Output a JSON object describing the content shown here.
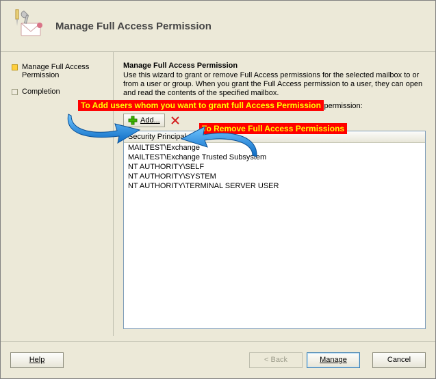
{
  "dialog": {
    "title": "Manage Full Access Permission"
  },
  "sidebar": {
    "steps": [
      {
        "label": "Manage Full Access Permission",
        "active": true
      },
      {
        "label": "Completion",
        "active": false
      }
    ]
  },
  "main": {
    "heading": "Manage Full Access Permission",
    "description": "Use this wizard to grant or remove Full Access permissions for the selected mailbox to or from a user or group. When you grant the Full Access permission to a user, they can open and read the contents of the specified mailbox.",
    "select_label": "Select the user(s) or group(s) to grant or remove full access permission:",
    "add_label": "Add...",
    "list_header": "Security Principal",
    "list_rows": [
      "MAILTEST\\Exchange",
      "MAILTEST\\Exchange Trusted Subsystem",
      "NT AUTHORITY\\SELF",
      "NT AUTHORITY\\SYSTEM",
      "NT AUTHORITY\\TERMINAL SERVER USER"
    ]
  },
  "annotations": {
    "add_users": "To Add users whom you want to grant full Access Permission",
    "remove_users": "To Remove Full Access Permissions"
  },
  "buttons": {
    "help": "Help",
    "back": "< Back",
    "manage": "Manage",
    "cancel": "Cancel"
  }
}
